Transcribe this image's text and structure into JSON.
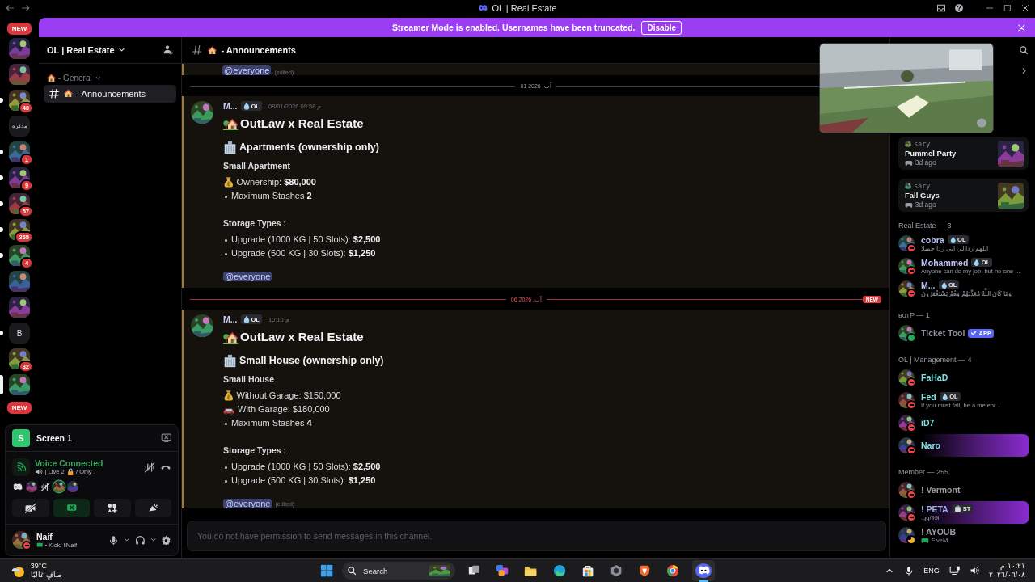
{
  "window": {
    "title": "OL | Real Estate"
  },
  "banner": {
    "text": "Streamer Mode is enabled. Usernames have been truncated.",
    "button": "Disable"
  },
  "rail": {
    "top_pill": "NEW",
    "bottom_pill": "NEW",
    "servers": [
      {
        "kind": "picture",
        "unread": false,
        "selected": false
      },
      {
        "kind": "picture",
        "unread": false,
        "selected": false
      },
      {
        "kind": "picture",
        "badge": "43",
        "unread": true,
        "selected": false
      },
      {
        "kind": "text",
        "label": "مذكره",
        "unread": false,
        "selected": false
      },
      {
        "kind": "picture",
        "badge": "1",
        "unread": true,
        "selected": false
      },
      {
        "kind": "picture",
        "badge": "9",
        "unread": true,
        "selected": false
      },
      {
        "kind": "picture",
        "badge": "57",
        "unread": true,
        "selected": false
      },
      {
        "kind": "picture",
        "badge": "365",
        "unread": true,
        "selected": false
      },
      {
        "kind": "picture",
        "badge": "4",
        "unread": true,
        "selected": false
      },
      {
        "kind": "picture",
        "unread": false,
        "selected": false
      },
      {
        "kind": "picture",
        "unread": false,
        "selected": false
      },
      {
        "kind": "text",
        "label": "B",
        "unread": true,
        "selected": false
      },
      {
        "kind": "picture",
        "badge": "32",
        "unread": false,
        "selected": false
      },
      {
        "kind": "picture",
        "unread": false,
        "selected": true
      }
    ]
  },
  "sidebar": {
    "server_name": "OL | Real Estate",
    "categories": [
      {
        "name": "- General",
        "expanded": true,
        "channels": [
          {
            "name": "- Announcements",
            "selected": true
          }
        ]
      }
    ]
  },
  "panel": {
    "stream": {
      "avatar_initial": "S",
      "title": "Screen 1"
    },
    "voice": {
      "status": "Voice Connected",
      "channel": "| Live 2",
      "channel_suffix": "/ Only ."
    },
    "participants": [
      {
        "kind": "logo",
        "speaking": false
      },
      {
        "kind": "picture",
        "speaking": false
      },
      {
        "kind": "icon",
        "speaking": false
      },
      {
        "kind": "picture",
        "speaking": true
      },
      {
        "kind": "picture",
        "speaking": false
      }
    ],
    "buttons": [
      {
        "kind": "camera",
        "on": false
      },
      {
        "kind": "screen",
        "on": true
      },
      {
        "kind": "activities",
        "on": false
      },
      {
        "kind": "soundboard",
        "on": false
      }
    ],
    "user": {
      "name": "Naif",
      "status_text": "• Kick/ llNaif",
      "presence": {
        "kind": "dnd",
        "color": "#f23f43"
      }
    }
  },
  "chat": {
    "channel": "- Announcements",
    "previous_tail": {
      "mention": "@everyone",
      "edited": "(edited)"
    },
    "items": [
      {
        "kind": "divider",
        "label": "01 2026 ,آب",
        "new": false
      },
      {
        "kind": "message",
        "author": "M...",
        "tag": "OL",
        "time": "08/01/2026 09:58 م",
        "highlighted": true,
        "blocks": [
          {
            "kind": "title",
            "text": "OutLaw x Real Estate"
          },
          {
            "kind": "subtitle",
            "text": "Apartments (ownership only)"
          },
          {
            "kind": "label",
            "text": "Small Apartment"
          },
          {
            "kind": "money",
            "text": "Ownership: **$80,000**"
          },
          {
            "kind": "bullet",
            "text": "Maximum Stashes **2**"
          },
          {
            "kind": "label",
            "text": "Storage Types :"
          },
          {
            "kind": "bullet",
            "text": "Upgrade (1000 KG | 50 Slots): **$2,500**"
          },
          {
            "kind": "bullet",
            "text": "Upgrade (500 KG | 30 Slots): **$1,250**"
          }
        ],
        "mention": "@everyone"
      },
      {
        "kind": "divider",
        "label": "06 2026 ,آب",
        "new": true,
        "pill": "NEW"
      },
      {
        "kind": "message",
        "author": "M...",
        "tag": "OL",
        "time": "10:10 م",
        "highlighted": true,
        "blocks": [
          {
            "kind": "title",
            "text": "OutLaw x Real Estate"
          },
          {
            "kind": "subtitle",
            "text": "Small House (ownership only)"
          },
          {
            "kind": "label",
            "text": "Small House"
          },
          {
            "kind": "money",
            "text": "Without Garage: $150,000"
          },
          {
            "kind": "car",
            "text": "With Garage: $180,000"
          },
          {
            "kind": "bullet",
            "text": "Maximum Stashes **4**"
          },
          {
            "kind": "label",
            "text": "Storage Types :"
          },
          {
            "kind": "bullet",
            "text": "Upgrade (1000 KG | 50 Slots): **$2,500**"
          },
          {
            "kind": "bullet",
            "text": "Upgrade (500 KG | 30 Slots): **$1,250**"
          }
        ],
        "mention": "@everyone",
        "edited": "(edited)"
      }
    ],
    "input": {
      "placeholder": "You do not have permission to send messages in this channel."
    }
  },
  "stream_preview": {
    "kind": "picture"
  },
  "members": {
    "activity": [
      {
        "user": "sary",
        "game": "Pummel Party",
        "time": "3d ago"
      },
      {
        "user": "sary",
        "game": "Fall Guys",
        "time": "3d ago"
      }
    ],
    "groups": [
      {
        "title": "Real Estate — 3",
        "members": [
          {
            "name": "cobra",
            "color": "#b9c3f5",
            "tag": "OL",
            "status_text": "اللهم ردا لي ابي ردا جميلا",
            "presence": {
              "kind": "dnd",
              "color": "#f23f43"
            },
            "highlight": false
          },
          {
            "name": "Mohammed",
            "color": "#b9c3f5",
            "tag": "OL",
            "status_text": "Anyone can do my job, but no-one ...",
            "presence": {
              "kind": "dnd",
              "color": "#f23f43"
            },
            "highlight": false
          },
          {
            "name": "M...",
            "color": "#b9c3f5",
            "tag": "OL",
            "status_text": "وَمَا كَانَ اللَّهُ مُعَذِّبَهُمْ وَهُمْ يَسْتَغْفِرُونَ",
            "presence": {
              "kind": "dnd",
              "color": "#f23f43"
            },
            "highlight": false
          }
        ]
      },
      {
        "title": "ʙᴏᴛP — 1",
        "members": [
          {
            "name": "Ticket Tool",
            "color": "#8e9199",
            "app_badge": "APP",
            "presence": {
              "kind": "online",
              "color": "#23a55a"
            },
            "highlight": false
          }
        ]
      },
      {
        "title": "OL | Management — 4",
        "members": [
          {
            "name": "FaHaD",
            "color": "#7fe3e6",
            "presence": {
              "kind": "dnd",
              "color": "#f23f43"
            },
            "highlight": false
          },
          {
            "name": "Fed",
            "color": "#7fe3e6",
            "tag": "OL",
            "status_text": "If you must fall, be a meteor ..",
            "presence": {
              "kind": "dnd",
              "color": "#f23f43"
            },
            "highlight": false
          },
          {
            "name": "iD7",
            "color": "#7fe3e6",
            "presence": {
              "kind": "dnd",
              "color": "#f23f43"
            },
            "highlight": false
          },
          {
            "name": "Naro",
            "color": "#7fe3e6",
            "presence": {
              "kind": "dnd",
              "color": "#f23f43"
            },
            "highlight": true
          }
        ]
      },
      {
        "title": "Member — 255",
        "members": [
          {
            "name": "! Vermont",
            "color": "#9a9ca3",
            "presence": {
              "kind": "dnd",
              "color": "#f23f43"
            },
            "highlight": false
          },
          {
            "name": "! PETA",
            "color": "#9fb0e6",
            "tag": "ST",
            "status_text": ".gg/99i",
            "presence": {
              "kind": "dnd",
              "color": "#f23f43"
            },
            "highlight": true
          },
          {
            "name": "! AYOUB",
            "color": "#9a9ca3",
            "game": "FiveM",
            "presence": {
              "kind": "idle",
              "color": "#f0b232"
            },
            "highlight": false
          }
        ]
      }
    ]
  },
  "taskbar": {
    "weather": {
      "temp": "39°C",
      "condition": "صافٍ غالبًا"
    },
    "search": {
      "placeholder": "Search"
    },
    "apps": [
      {
        "kind": "taskview",
        "active": false
      },
      {
        "kind": "squares",
        "active": false
      },
      {
        "kind": "folder",
        "active": false
      },
      {
        "kind": "globe",
        "active": false
      },
      {
        "kind": "bag",
        "active": false
      },
      {
        "kind": "hexagon",
        "active": false
      },
      {
        "kind": "shield",
        "active": false
      },
      {
        "kind": "circle",
        "active": false
      },
      {
        "kind": "logo",
        "active": true
      }
    ],
    "tray": {
      "language": "ENG",
      "time": "١٠:٢١ م",
      "date": "٢٠٢٦/٠٦/٠٨"
    }
  }
}
